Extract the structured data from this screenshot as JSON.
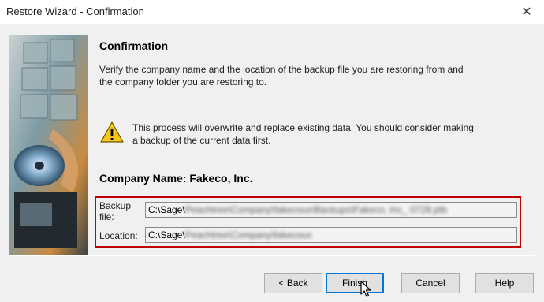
{
  "window": {
    "title": "Restore Wizard - Confirmation",
    "close_glyph": "✕"
  },
  "page": {
    "heading": "Confirmation",
    "description": "Verify the company name and the location of the backup file you are restoring from and the company folder you are restoring to.",
    "warning": "This process will overwrite and replace existing data.  You should consider making a backup of the current data first.",
    "warning_icon": "warning-icon",
    "company_name": "Company Name: Fakeco, Inc."
  },
  "fields": {
    "backup_label": "Backup file:",
    "backup_prefix": "C:\\Sage\\",
    "backup_obscured": "Peachtree\\Company\\fakecoux\\Backups\\Fakeco, Inc_ 0728.ptb",
    "location_label": "Location:",
    "location_prefix": "C:\\Sage\\",
    "location_obscured": "Peachtree\\Company\\fakecoux"
  },
  "buttons": {
    "back": "< Back",
    "finish": "Finish",
    "cancel": "Cancel",
    "help": "Help"
  },
  "colors": {
    "highlight_border": "#c00000",
    "focus_border": "#0078d7"
  }
}
